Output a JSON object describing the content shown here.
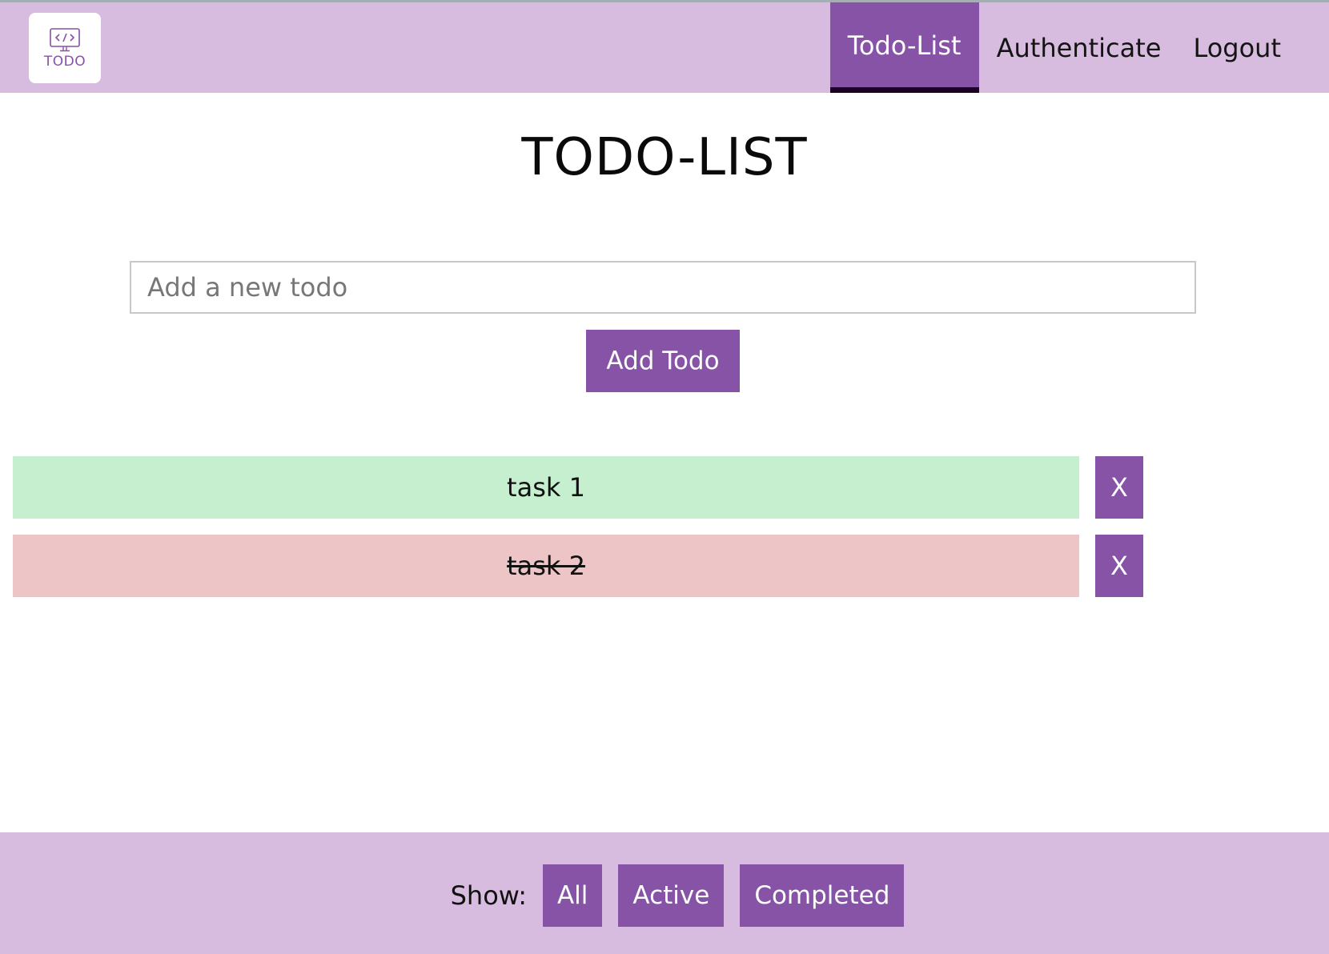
{
  "header": {
    "logo_text": "TODO",
    "nav": [
      {
        "label": "Todo-List",
        "active": true
      },
      {
        "label": "Authenticate",
        "active": false
      },
      {
        "label": "Logout",
        "active": false
      }
    ]
  },
  "main": {
    "title": "TODO-LIST",
    "input": {
      "placeholder": "Add a new todo",
      "value": ""
    },
    "add_button_label": "Add Todo",
    "todos": [
      {
        "text": "task 1",
        "status": "completed",
        "delete_label": "X"
      },
      {
        "text": "task 2",
        "status": "active",
        "delete_label": "X"
      }
    ]
  },
  "footer": {
    "show_label": "Show:",
    "filters": [
      {
        "label": "All"
      },
      {
        "label": "Active"
      },
      {
        "label": "Completed"
      }
    ]
  },
  "colors": {
    "accent": "#8753a7",
    "header_bg": "#d7bcdf",
    "completed_bg": "#c6efd0",
    "active_bg": "#eec5c7"
  }
}
